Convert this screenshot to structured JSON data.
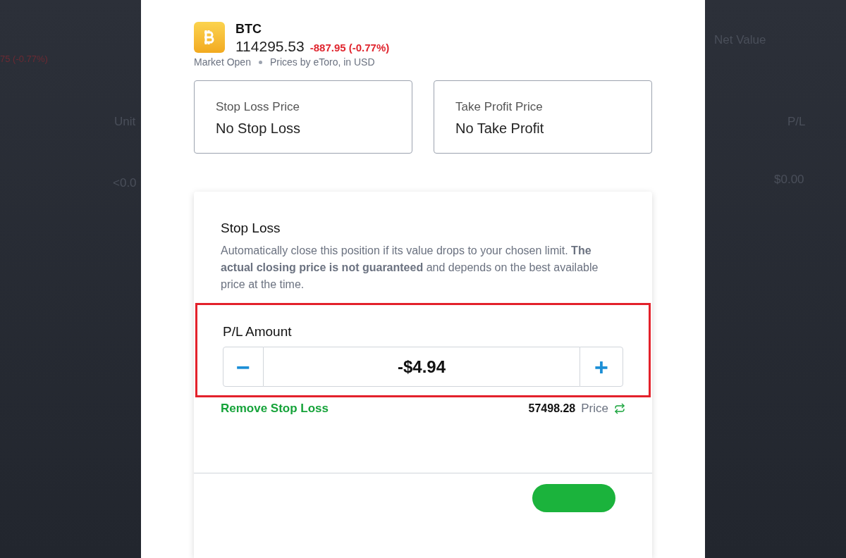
{
  "background": {
    "left": {
      "change": "75 (-0.77%)",
      "column": "Unit",
      "value": "<0.0"
    },
    "right": {
      "header": "Net Value",
      "column": "P/L",
      "value": "$0.00"
    }
  },
  "instrument": {
    "symbol": "BTC",
    "price": "114295.53",
    "change": "-887.95 (-0.77%)",
    "status": "Market Open",
    "source": "Prices by eToro, in USD"
  },
  "summary": [
    {
      "label": "Stop Loss Price",
      "value": "No Stop Loss"
    },
    {
      "label": "Take Profit Price",
      "value": "No Take Profit"
    }
  ],
  "stop_loss": {
    "title": "Stop Loss",
    "description": "Automatically close this position if its value drops to your chosen limit. **The actual closing price is not guaranteed** and depends on the best available price at the time.",
    "highlighted": true,
    "field_label": "P/L Amount",
    "minus": "−",
    "amount": "-$4.94",
    "plus": "+",
    "remove_link": "Remove Stop Loss",
    "price_value": "57498.28",
    "price_label": "Price"
  }
}
